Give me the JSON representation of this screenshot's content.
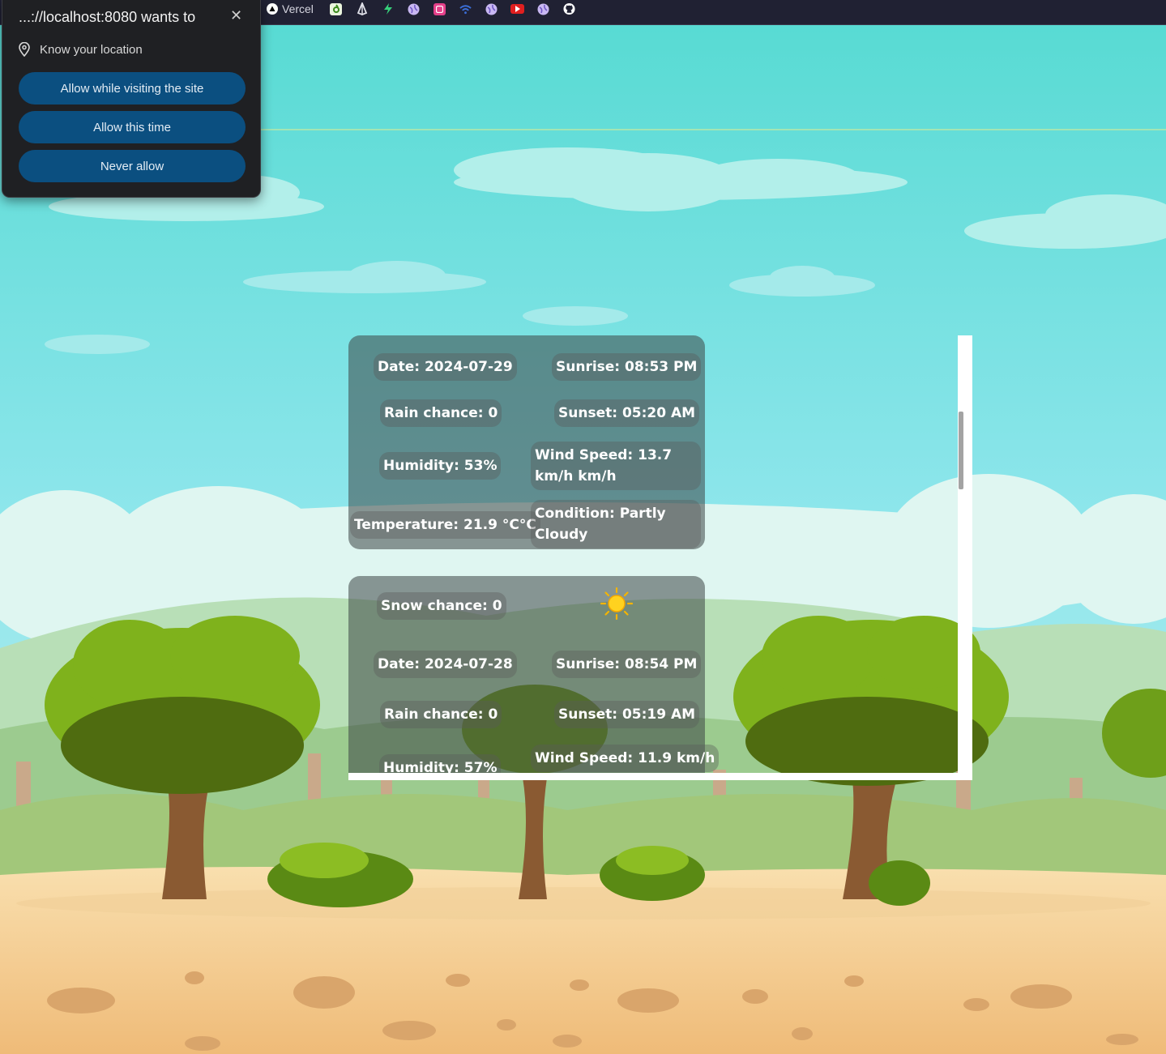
{
  "bookmarks": [
    {
      "icon": "vercel-triangle-icon",
      "label": "Vercel"
    },
    {
      "icon": "green-app-icon",
      "label": ""
    },
    {
      "icon": "sail-icon",
      "label": ""
    },
    {
      "icon": "bolt-icon",
      "label": ""
    },
    {
      "icon": "globe-icon",
      "label": ""
    },
    {
      "icon": "pink-square-icon",
      "label": ""
    },
    {
      "icon": "wifi-icon",
      "label": ""
    },
    {
      "icon": "globe-icon",
      "label": ""
    },
    {
      "icon": "youtube-icon",
      "label": ""
    },
    {
      "icon": "globe-icon",
      "label": ""
    },
    {
      "icon": "github-icon",
      "label": ""
    }
  ],
  "permission_prompt": {
    "title": "...://localhost:8080 wants to",
    "close": "✕",
    "request": "Know your location",
    "buttons": {
      "allow_visiting": "Allow while visiting the site",
      "allow_once": "Allow this time",
      "never": "Never allow"
    }
  },
  "forecast": [
    {
      "date": "Date: 2024-07-29",
      "sunrise": "Sunrise: 08:53 PM",
      "rain": "Rain chance: 0",
      "sunset": "Sunset: 05:20 AM",
      "humidity": "Humidity: 53%",
      "wind": "Wind Speed: 13.7 km/h km/h",
      "temperature": "Temperature: 21.9 °C°C",
      "condition": "Condition: Partly Cloudy"
    },
    {
      "snow": "Snow chance: 0",
      "icon": "sun-icon",
      "date": "Date: 2024-07-28",
      "sunrise": "Sunrise: 08:54 PM",
      "rain": "Rain chance: 0",
      "sunset": "Sunset: 05:19 AM",
      "humidity": "Humidity: 57%",
      "wind": "Wind Speed: 11.9 km/h"
    }
  ],
  "colors": {
    "sky": "#5fd9d4",
    "popup": "#1f2023",
    "button": "#0b4f80",
    "bookmark_bar": "#202133"
  }
}
